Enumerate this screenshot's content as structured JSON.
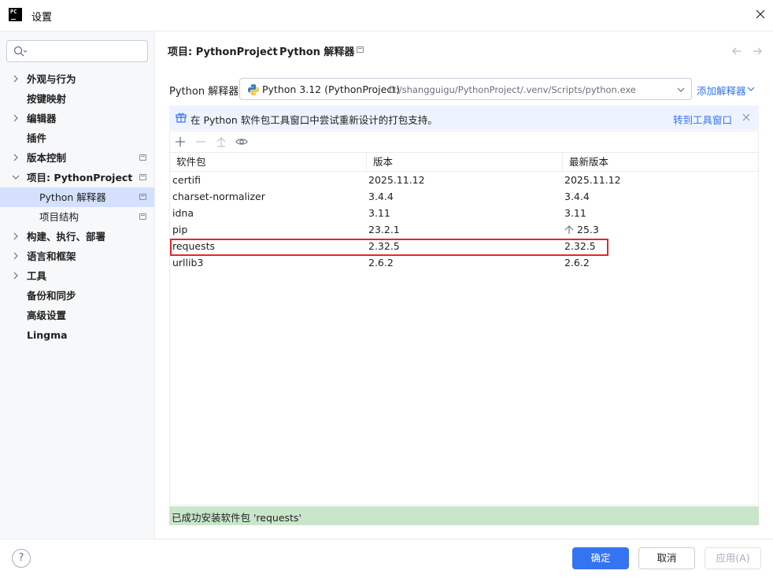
{
  "window": {
    "title": "设置"
  },
  "search": {
    "placeholder": ""
  },
  "sidebar": {
    "items": [
      {
        "label": "外观与行为",
        "expandable": true,
        "pinned": false
      },
      {
        "label": "按键映射",
        "expandable": false,
        "pinned": false
      },
      {
        "label": "编辑器",
        "expandable": true,
        "pinned": false
      },
      {
        "label": "插件",
        "expandable": false,
        "pinned": false
      },
      {
        "label": "版本控制",
        "expandable": true,
        "pinned": true
      },
      {
        "label": "项目: PythonProject",
        "expandable": true,
        "expanded": true,
        "pinned": true
      },
      {
        "label": "Python 解释器",
        "sub": true,
        "selected": true,
        "pinned": true
      },
      {
        "label": "项目结构",
        "sub": true,
        "pinned": true
      },
      {
        "label": "构建、执行、部署",
        "expandable": true,
        "pinned": false
      },
      {
        "label": "语言和框架",
        "expandable": true,
        "pinned": false
      },
      {
        "label": "工具",
        "expandable": true,
        "pinned": false
      },
      {
        "label": "备份和同步",
        "expandable": false,
        "pinned": false
      },
      {
        "label": "高级设置",
        "expandable": false,
        "pinned": false
      },
      {
        "label": "Lingma",
        "expandable": false,
        "pinned": false
      }
    ]
  },
  "breadcrumb": {
    "parent": "项目: PythonProject",
    "separator": "›",
    "current": "Python 解释器"
  },
  "interpreter": {
    "label": "Python 解释器:",
    "selected_name": "Python 3.12 (PythonProject)",
    "selected_path": "D:/shangguigu/PythonProject/.venv/Scripts/python.exe",
    "add_label": "添加解释器"
  },
  "banner": {
    "message": "在 Python 软件包工具窗口中尝试重新设计的打包支持。",
    "link": "转到工具窗口"
  },
  "packages": {
    "columns": [
      "软件包",
      "版本",
      "最新版本"
    ],
    "rows": [
      {
        "name": "certifi",
        "version": "2025.11.12",
        "latest": "2025.11.12",
        "upgrade": false
      },
      {
        "name": "charset-normalizer",
        "version": "3.4.4",
        "latest": "3.4.4",
        "upgrade": false
      },
      {
        "name": "idna",
        "version": "3.11",
        "latest": "3.11",
        "upgrade": false
      },
      {
        "name": "pip",
        "version": "23.2.1",
        "latest": "25.3",
        "upgrade": true
      },
      {
        "name": "requests",
        "version": "2.32.5",
        "latest": "2.32.5",
        "upgrade": false,
        "highlighted": true
      },
      {
        "name": "urllib3",
        "version": "2.6.2",
        "latest": "2.6.2",
        "upgrade": false
      }
    ]
  },
  "status": {
    "message": "已成功安装软件包 'requests'"
  },
  "footer": {
    "help": "?",
    "ok": "确定",
    "cancel": "取消",
    "apply": "应用(A)"
  },
  "colors": {
    "accent": "#3574f0",
    "selection": "#d5e1fc",
    "success_bg": "#c9e6cb",
    "banner_bg": "#edf3ff",
    "highlight_border": "#e02a2a"
  }
}
